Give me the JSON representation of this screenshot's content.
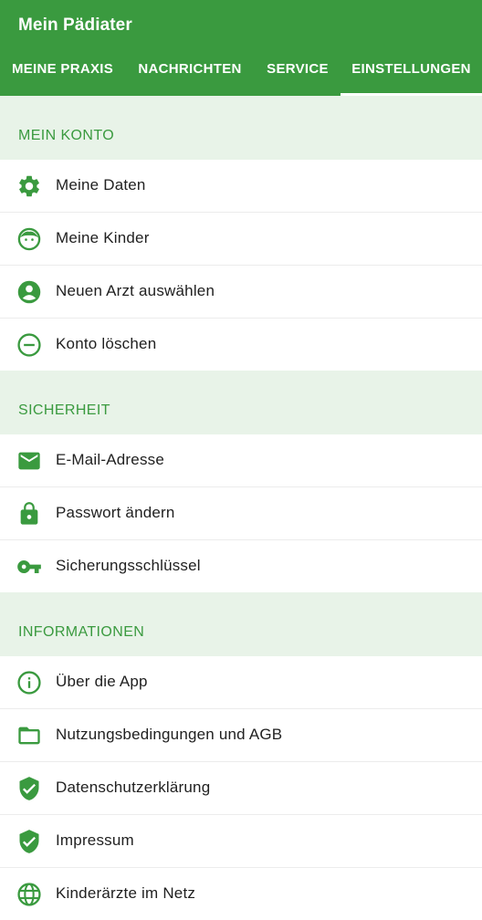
{
  "app": {
    "title": "Mein Pädiater"
  },
  "tabs": [
    {
      "label": "MEINE PRAXIS"
    },
    {
      "label": "NACHRICHTEN"
    },
    {
      "label": "SERVICE"
    },
    {
      "label": "EINSTELLUNGEN",
      "active": true
    }
  ],
  "colors": {
    "primary": "#3a9a3f",
    "section_bg": "#e8f3e8",
    "text": "#212121"
  },
  "sections": [
    {
      "title": "MEIN KONTO",
      "items": [
        {
          "label": "Meine Daten",
          "icon": "gear-icon"
        },
        {
          "label": "Meine Kinder",
          "icon": "child-face-icon"
        },
        {
          "label": "Neuen Arzt auswählen",
          "icon": "account-circle-icon"
        },
        {
          "label": "Konto löschen",
          "icon": "remove-circle-icon"
        }
      ]
    },
    {
      "title": "SICHERHEIT",
      "items": [
        {
          "label": "E-Mail-Adresse",
          "icon": "mail-icon"
        },
        {
          "label": "Passwort ändern",
          "icon": "lock-icon"
        },
        {
          "label": "Sicherungsschlüssel",
          "icon": "key-icon"
        }
      ]
    },
    {
      "title": "INFORMATIONEN",
      "items": [
        {
          "label": "Über die App",
          "icon": "info-icon"
        },
        {
          "label": "Nutzungsbedingungen und AGB",
          "icon": "folder-icon"
        },
        {
          "label": "Datenschutzerklärung",
          "icon": "shield-check-icon"
        },
        {
          "label": "Impressum",
          "icon": "shield-check-icon"
        },
        {
          "label": "Kinderärzte im Netz",
          "icon": "globe-icon"
        }
      ]
    }
  ]
}
